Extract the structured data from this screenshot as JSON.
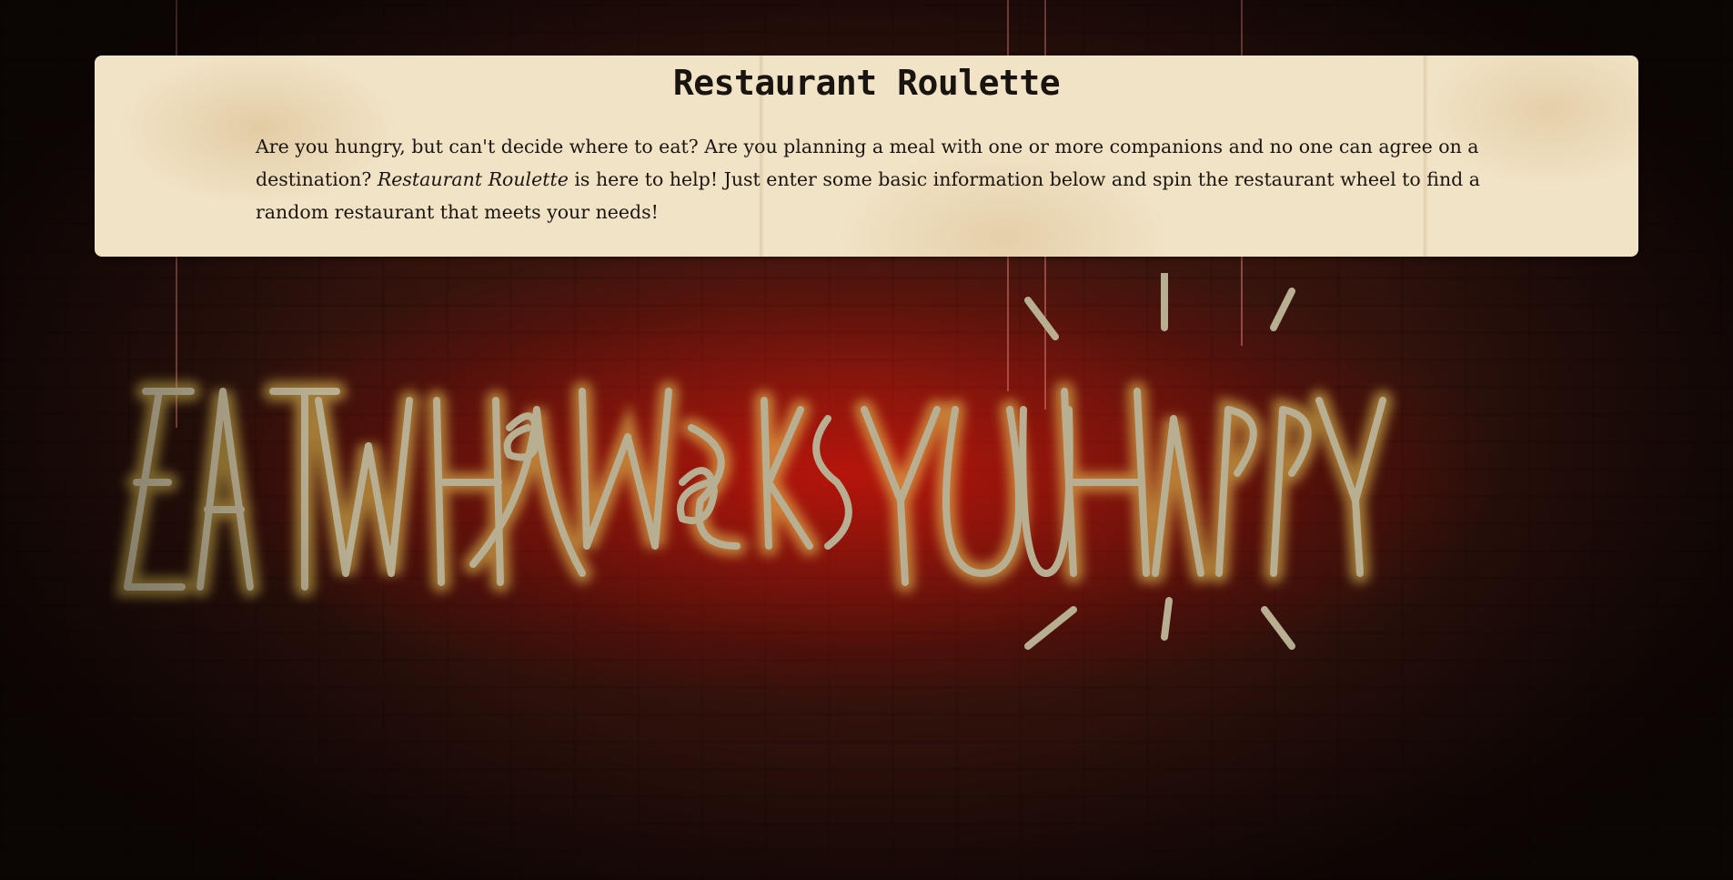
{
  "page": {
    "title": "Restaurant Roulette",
    "intro_part1": "Are you hungry, but can't decide where to eat? Are you planning a meal with one or more companions and no one can agree on a destination? ",
    "intro_emphasis": "Restaurant Roulette",
    "intro_part2": " is here to help! Just enter some basic information below and spin the restaurant wheel to find a random restaurant that meets your needs!"
  },
  "background": {
    "neon_sign_text": "EAT WHat MaKes YOU HaPPY",
    "description": "Neon sign on red brick wall"
  },
  "colors": {
    "card_background": "#f1e3c6",
    "text": "#1c1612",
    "neon_glow": "#e01a0a",
    "neon_tube": "#b8ae92"
  }
}
